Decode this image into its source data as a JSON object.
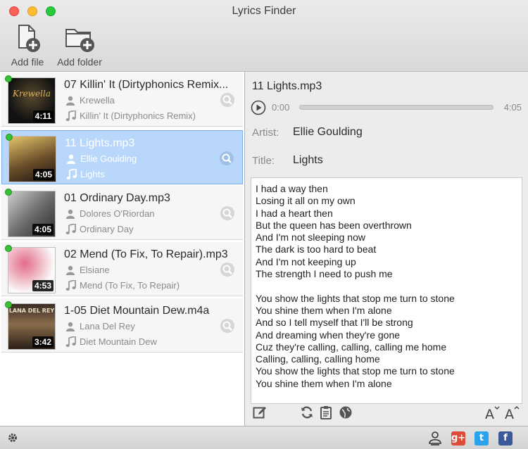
{
  "window": {
    "title": "Lyrics Finder"
  },
  "toolbar": {
    "add_file": "Add file",
    "add_folder": "Add folder"
  },
  "tracks": [
    {
      "name": "07 Killin' It (Dirtyphonics Remix...",
      "artist": "Krewella",
      "title": "Killin' It (Dirtyphonics Remix)",
      "duration": "4:11",
      "selected": false
    },
    {
      "name": "11 Lights.mp3",
      "artist": "Ellie Goulding",
      "title": "Lights",
      "duration": "4:05",
      "selected": true
    },
    {
      "name": "01 Ordinary Day.mp3",
      "artist": "Dolores O'Riordan",
      "title": "Ordinary Day",
      "duration": "4:05",
      "selected": false
    },
    {
      "name": "02 Mend (To Fix, To Repair).mp3",
      "artist": "Elsiane",
      "title": "Mend (To Fix, To Repair)",
      "duration": "4:53",
      "selected": false
    },
    {
      "name": "1-05 Diet Mountain Dew.m4a",
      "artist": "Lana Del Rey",
      "title": "Diet Mountain Dew",
      "duration": "3:42",
      "selected": false
    }
  ],
  "detail": {
    "file": "11 Lights.mp3",
    "time_current": "0:00",
    "time_total": "4:05",
    "artist_label": "Artist:",
    "artist": "Ellie Goulding",
    "title_label": "Title:",
    "title": "Lights",
    "lyrics": [
      "I had a way then",
      "Losing it all on my own",
      "I had a heart then",
      "But the queen has been overthrown",
      "And I'm not sleeping now",
      "The dark is too hard to beat",
      "And I'm not keeping up",
      "The strength I need to push me",
      "",
      "You show the lights that stop me turn to stone",
      "You shine them when I'm alone",
      "And so I tell myself that I'll be strong",
      "And dreaming when they're gone",
      "Cuz they're calling, calling, calling me home",
      "Calling, calling, calling home",
      "You show the lights that stop me turn to stone",
      "You shine them when I'm alone"
    ]
  },
  "icons": {
    "edit": "edit-icon",
    "refresh": "refresh-icon",
    "clipboard": "clipboard-icon",
    "web": "globe-icon",
    "font_up": "font-increase-icon",
    "font_down": "font-decrease-icon",
    "settings": "gear-icon"
  },
  "social": {
    "google": "g+",
    "twitter": "t",
    "facebook": "f"
  },
  "colors": {
    "selection": "#b9d7fb",
    "status_dot": "#36c236",
    "twitter": "#2aa3ef",
    "facebook": "#3b5998",
    "google": "#dd4b39"
  }
}
